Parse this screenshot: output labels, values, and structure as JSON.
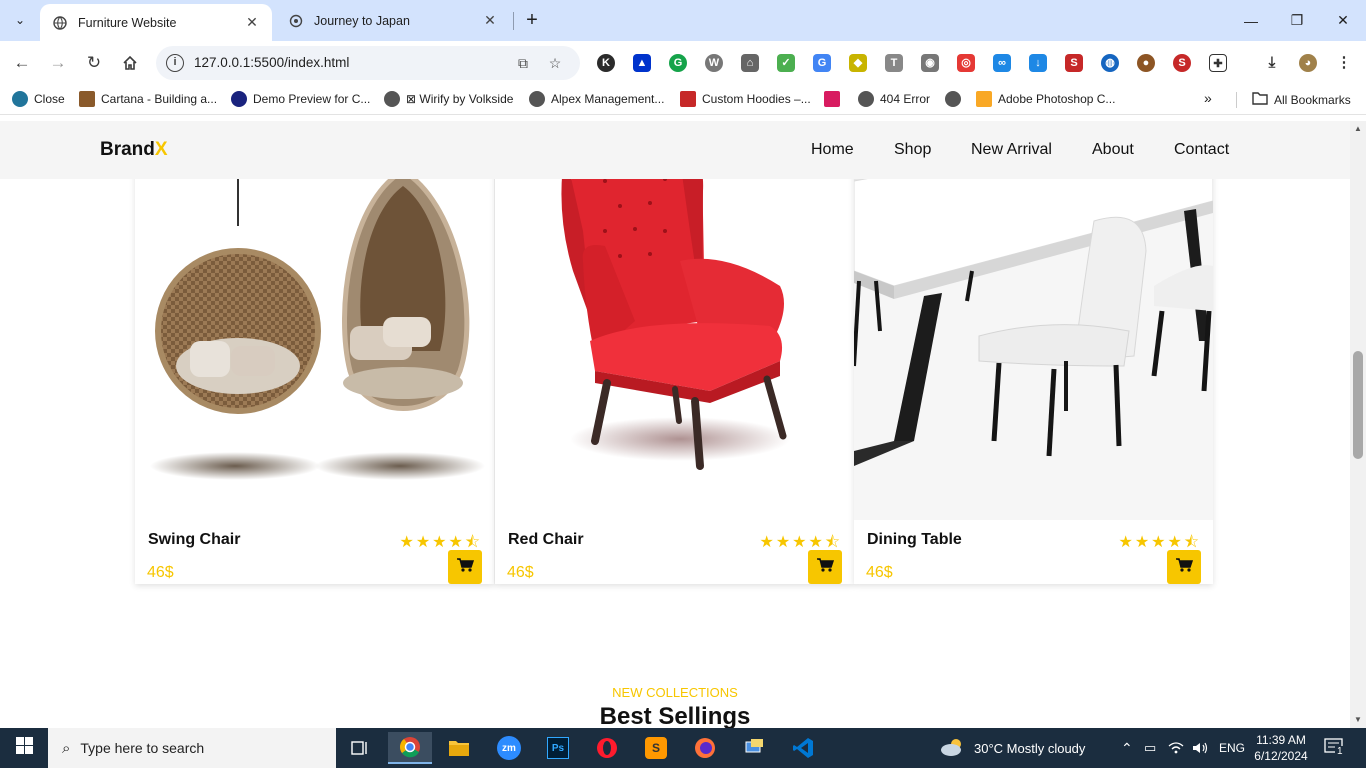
{
  "browser": {
    "tabs": [
      {
        "title": "Furniture Website",
        "active": true
      },
      {
        "title": "Journey to Japan",
        "active": false
      }
    ],
    "url": "127.0.0.1:5500/index.html",
    "bookmarks": [
      {
        "label": "Close",
        "color": "#21759b"
      },
      {
        "label": "Cartana - Building a...",
        "color": "#8a5a2b"
      },
      {
        "label": "Demo Preview for C...",
        "color": "#1a237e"
      },
      {
        "label": "⊠ Wirify by Volkside",
        "color": "#555555"
      },
      {
        "label": "Alpex Management...",
        "color": "#555555"
      },
      {
        "label": "Custom Hoodies –...",
        "color": "#c62828"
      },
      {
        "label": "",
        "color": "#d81b60"
      },
      {
        "label": "404 Error",
        "color": "#555555"
      },
      {
        "label": "",
        "color": "#555555"
      },
      {
        "label": "Adobe Photoshop C...",
        "color": "#f9a825"
      }
    ],
    "all_bookmarks": "All Bookmarks"
  },
  "site": {
    "logo_main": "Brand",
    "logo_accent": "X",
    "nav": [
      "Home",
      "Shop",
      "New Arrival",
      "About",
      "Contact"
    ],
    "products": [
      {
        "name": "Swing Chair",
        "price": "46$",
        "stars": "★★★★⯪",
        "rating": 4.5
      },
      {
        "name": "Red Chair",
        "price": "46$",
        "stars": "★★★★⯪",
        "rating": 4.5
      },
      {
        "name": "Dining Table",
        "price": "46$",
        "stars": "★★★★⯪",
        "rating": 4.5
      }
    ],
    "collections_label": "NEW COLLECTIONS",
    "collections_title": "Best Sellings",
    "accent_color": "#f7c600"
  },
  "taskbar": {
    "search_placeholder": "Type here to search",
    "weather": "30°C  Mostly cloudy",
    "lang": "ENG",
    "time": "11:39 AM",
    "date": "6/12/2024",
    "notifications": "1"
  }
}
